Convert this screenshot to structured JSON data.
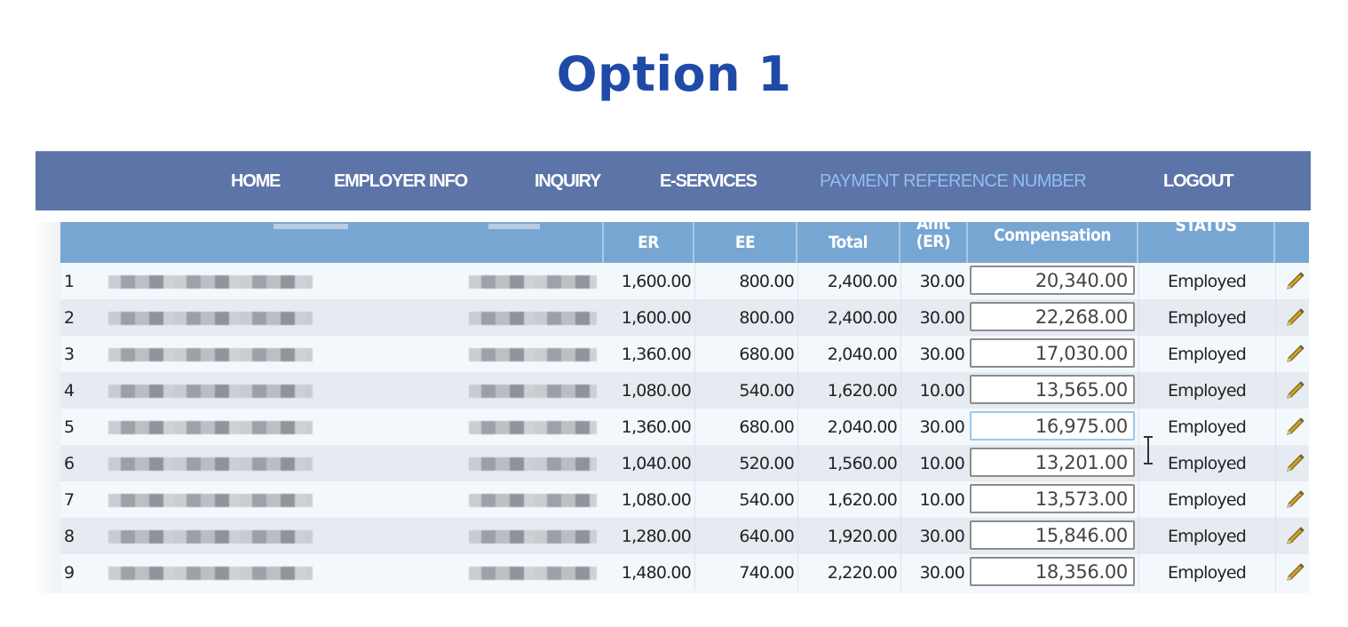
{
  "title": "Option 1",
  "nav": {
    "items": [
      {
        "label": "HOME",
        "active": false
      },
      {
        "label": "EMPLOYER INFO",
        "active": false
      },
      {
        "label": "INQUIRY",
        "active": false
      },
      {
        "label": "E-SERVICES",
        "active": false
      },
      {
        "label": "PAYMENT REFERENCE NUMBER",
        "active": true
      },
      {
        "label": "LOGOUT",
        "active": false
      }
    ]
  },
  "table": {
    "headers": {
      "name": "",
      "id": "",
      "er": "ER",
      "ee": "EE",
      "total": "Total",
      "amt_er_line1": "Amt",
      "amt_er_line2": "(ER)",
      "compensation": "Compensation",
      "status": "STATUS",
      "action": ""
    },
    "rows": [
      {
        "no": "1",
        "name": "[redacted]",
        "id": "[redacted]",
        "er": "1,600.00",
        "ee": "800.00",
        "total": "2,400.00",
        "amt_er": "30.00",
        "compensation": "20,340.00",
        "status": "Employed"
      },
      {
        "no": "2",
        "name": "[redacted]",
        "id": "[redacted]",
        "er": "1,600.00",
        "ee": "800.00",
        "total": "2,400.00",
        "amt_er": "30.00",
        "compensation": "22,268.00",
        "status": "Employed"
      },
      {
        "no": "3",
        "name": "[redacted]",
        "id": "[redacted]",
        "er": "1,360.00",
        "ee": "680.00",
        "total": "2,040.00",
        "amt_er": "30.00",
        "compensation": "17,030.00",
        "status": "Employed"
      },
      {
        "no": "4",
        "name": "[redacted]",
        "id": "[redacted]",
        "er": "1,080.00",
        "ee": "540.00",
        "total": "1,620.00",
        "amt_er": "10.00",
        "compensation": "13,565.00",
        "status": "Employed"
      },
      {
        "no": "5",
        "name": "[redacted]",
        "id": "[redacted]",
        "er": "1,360.00",
        "ee": "680.00",
        "total": "2,040.00",
        "amt_er": "30.00",
        "compensation": "16,975.00",
        "status": "Employed",
        "focused": true
      },
      {
        "no": "6",
        "name": "[redacted]",
        "id": "[redacted]",
        "er": "1,040.00",
        "ee": "520.00",
        "total": "1,560.00",
        "amt_er": "10.00",
        "compensation": "13,201.00",
        "status": "Employed"
      },
      {
        "no": "7",
        "name": "[redacted]",
        "id": "[redacted]",
        "er": "1,080.00",
        "ee": "540.00",
        "total": "1,620.00",
        "amt_er": "10.00",
        "compensation": "13,573.00",
        "status": "Employed"
      },
      {
        "no": "8",
        "name": "[redacted]",
        "id": "[redacted]",
        "er": "1,280.00",
        "ee": "640.00",
        "total": "1,920.00",
        "amt_er": "30.00",
        "compensation": "15,846.00",
        "status": "Employed"
      },
      {
        "no": "9",
        "name": "[redacted]",
        "id": "[redacted]",
        "er": "1,480.00",
        "ee": "740.00",
        "total": "2,220.00",
        "amt_er": "30.00",
        "compensation": "18,356.00",
        "status": "Employed"
      }
    ],
    "edit_icon": "pencil-icon"
  },
  "colors": {
    "title": "#1f4aa8",
    "navbar": "#5d74a8",
    "nav_active": "#8fc0ef",
    "table_header": "#78a6d2"
  }
}
